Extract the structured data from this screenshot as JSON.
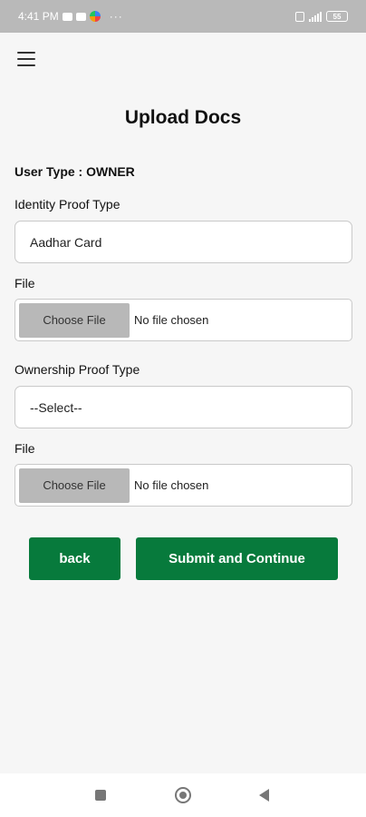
{
  "status_bar": {
    "time": "4:41 PM",
    "dots": "···",
    "sim_text": "",
    "battery": "55",
    "icons": [
      "youtube-icon",
      "youtube-icon",
      "photos-icon",
      "sim-icon",
      "signal-icon",
      "battery-icon"
    ]
  },
  "header": {
    "menu_icon": "hamburger-menu-icon",
    "title": "Upload Docs"
  },
  "form": {
    "user_type": "User Type : OWNER",
    "identity_label": "Identity Proof Type",
    "identity_value": "Aadhar Card",
    "file1_label": "File",
    "file1_button": "Choose File",
    "file1_status": "No file chosen",
    "ownership_label": "Ownership Proof Type",
    "ownership_value": "--Select--",
    "file2_label": "File",
    "file2_button": "Choose File",
    "file2_status": "No file chosen"
  },
  "actions": {
    "back_label": "back",
    "submit_label": "Submit and Continue"
  },
  "colors": {
    "primary": "#077a3c",
    "status_bar": "#b9b9b9",
    "background": "#f6f6f6"
  },
  "nav": {
    "icons": [
      "recent-apps-icon",
      "home-icon",
      "back-icon"
    ]
  }
}
